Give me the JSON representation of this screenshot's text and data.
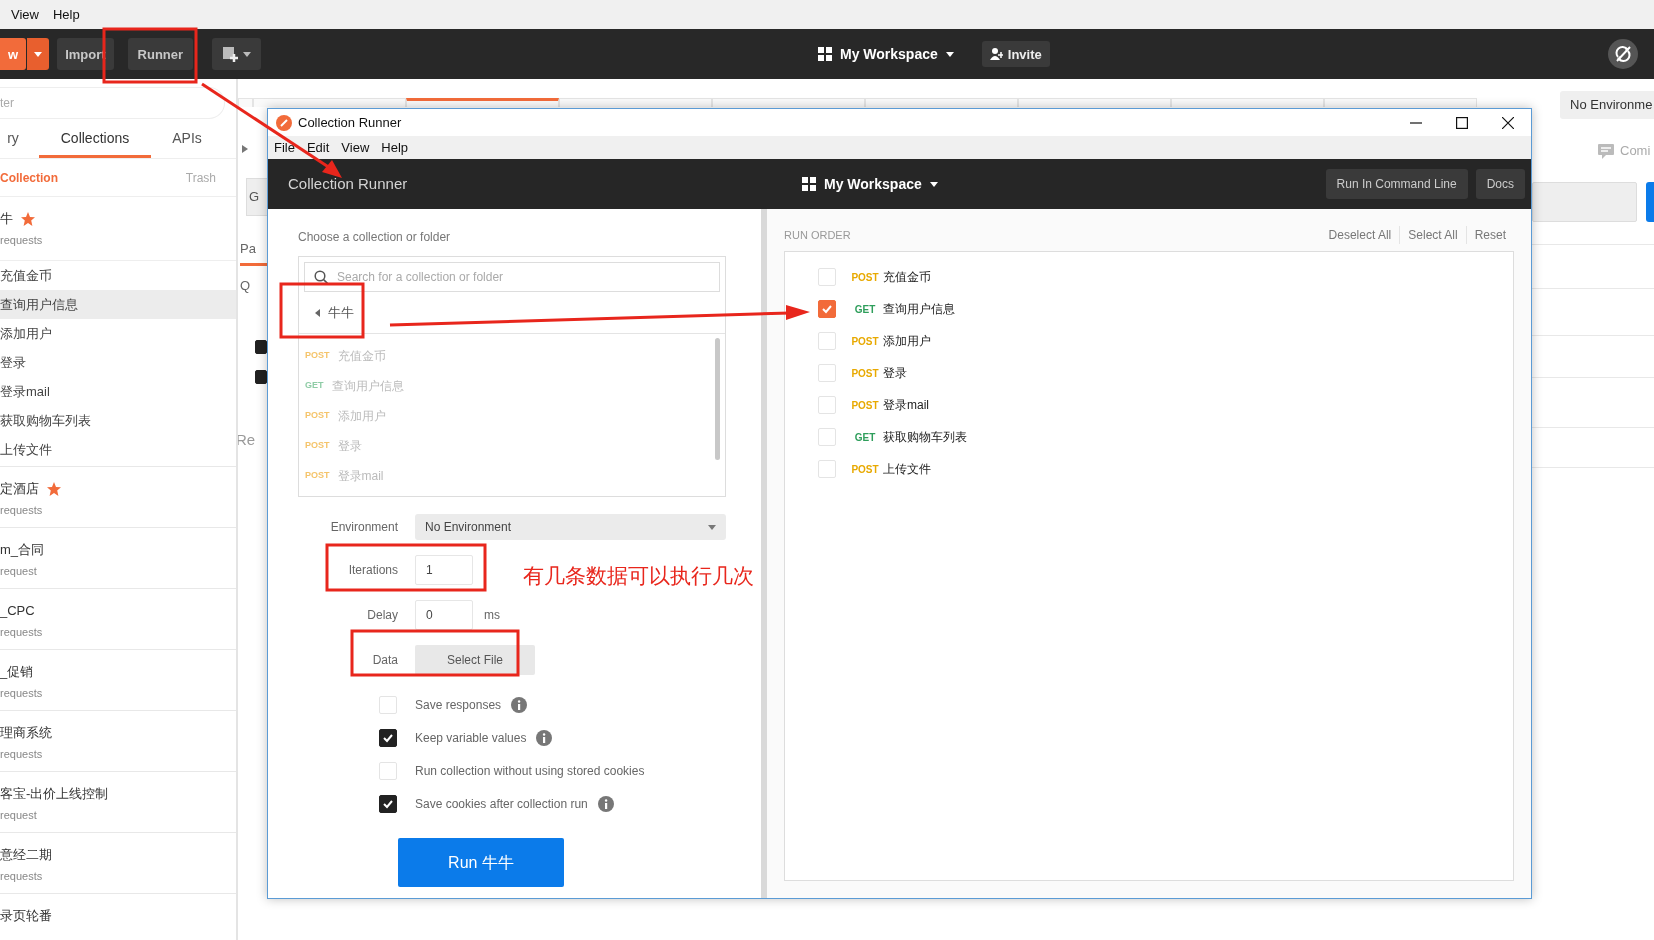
{
  "app_menu": [
    "View",
    "Help"
  ],
  "toolbar": {
    "new_button": "w",
    "import_button": "Import",
    "runner_button": "Runner",
    "workspace": "My Workspace",
    "invite_button": "Invite"
  },
  "sidebar": {
    "filter_placeholder": "ter",
    "tabs": [
      {
        "label": "ry",
        "selected": false
      },
      {
        "label": "Collections",
        "selected": true
      },
      {
        "label": "APIs",
        "selected": false
      }
    ],
    "new_collection": "Collection",
    "trash": "Trash",
    "collections": [
      {
        "name": "牛",
        "starred": true,
        "count": "requests",
        "requests": [
          {
            "name": "充值金币",
            "selected": false
          },
          {
            "name": "查询用户信息",
            "selected": true
          },
          {
            "name": "添加用户",
            "selected": false
          },
          {
            "name": "登录",
            "selected": false
          },
          {
            "name": "登录mail",
            "selected": false
          },
          {
            "name": "获取购物车列表",
            "selected": false
          },
          {
            "name": "上传文件",
            "selected": false
          }
        ]
      },
      {
        "name": "定酒店",
        "starred": true,
        "count": "requests"
      },
      {
        "name": "m_合同",
        "starred": false,
        "count": "request"
      },
      {
        "name": "_CPC",
        "starred": false,
        "count": "requests"
      },
      {
        "name": "_促销",
        "starred": false,
        "count": "requests"
      },
      {
        "name": "理商系统",
        "starred": false,
        "count": "requests"
      },
      {
        "name": "客宝-出价上线控制",
        "starred": false,
        "count": "request"
      },
      {
        "name": "意经二期",
        "starred": false,
        "count": "requests"
      },
      {
        "name": "录页轮番",
        "starred": false
      }
    ]
  },
  "main": {
    "tabs": [
      {
        "selected": false
      },
      {
        "selected": false
      },
      {
        "selected": true
      },
      {
        "selected": false
      },
      {
        "selected": false
      },
      {
        "selected": false
      },
      {
        "selected": false
      },
      {
        "selected": false
      },
      {
        "selected": false
      }
    ],
    "left_fragments": [
      "G",
      "Pa",
      "Q",
      "Re"
    ],
    "checkboxes": [
      {
        "checked": true
      },
      {
        "checked": true
      }
    ],
    "environment": "No Environme",
    "comments": "Comi"
  },
  "runner": {
    "title": "Collection Runner",
    "menu": [
      "File",
      "Edit",
      "View",
      "Help"
    ],
    "header_title": "Collection Runner",
    "workspace": "My Workspace",
    "header_buttons": [
      "Run In Command Line",
      "Docs"
    ],
    "chooser_label": "Choose a collection or folder",
    "search_placeholder": "Search for a collection or folder",
    "folder": "牛牛",
    "folder_items": [
      {
        "method": "POST",
        "color": "#f5c46a",
        "name": "充值金币"
      },
      {
        "method": "GET",
        "color": "#8fcca6",
        "name": "查询用户信息"
      },
      {
        "method": "POST",
        "color": "#f5c46a",
        "name": "添加用户"
      },
      {
        "method": "POST",
        "color": "#f5c46a",
        "name": "登录"
      },
      {
        "method": "POST",
        "color": "#f5c46a",
        "name": "登录mail"
      }
    ],
    "environment_label": "Environment",
    "environment": "No Environment",
    "iterations_label": "Iterations",
    "iterations": "1",
    "delay_label": "Delay",
    "delay": "0",
    "delay_unit": "ms",
    "data_label": "Data",
    "data_button": "Select File",
    "options": [
      {
        "label": "Save responses",
        "checked": false,
        "info": true
      },
      {
        "label": "Keep variable values",
        "checked": true,
        "info": true
      },
      {
        "label": "Run collection without using stored cookies",
        "checked": false,
        "info": false
      },
      {
        "label": "Save cookies after collection run",
        "checked": true,
        "info": true
      }
    ],
    "run_button": "Run 牛牛",
    "run_order": {
      "title": "RUN ORDER",
      "actions": [
        "Deselect All",
        "Select All",
        "Reset"
      ],
      "items": [
        {
          "method": "POST",
          "color": "#e8a900",
          "name": "充值金币",
          "checked": false
        },
        {
          "method": "GET",
          "color": "#2e9e5b",
          "name": "查询用户信息",
          "checked": true
        },
        {
          "method": "POST",
          "color": "#e8a900",
          "name": "添加用户",
          "checked": false
        },
        {
          "method": "POST",
          "color": "#e8a900",
          "name": "登录",
          "checked": false
        },
        {
          "method": "POST",
          "color": "#e8a900",
          "name": "登录mail",
          "checked": false
        },
        {
          "method": "GET",
          "color": "#2e9e5b",
          "name": "获取购物车列表",
          "checked": false
        },
        {
          "method": "POST",
          "color": "#e8a900",
          "name": "上传文件",
          "checked": false
        }
      ]
    }
  },
  "annotation": {
    "note": "有几条数据可以执行几次"
  }
}
